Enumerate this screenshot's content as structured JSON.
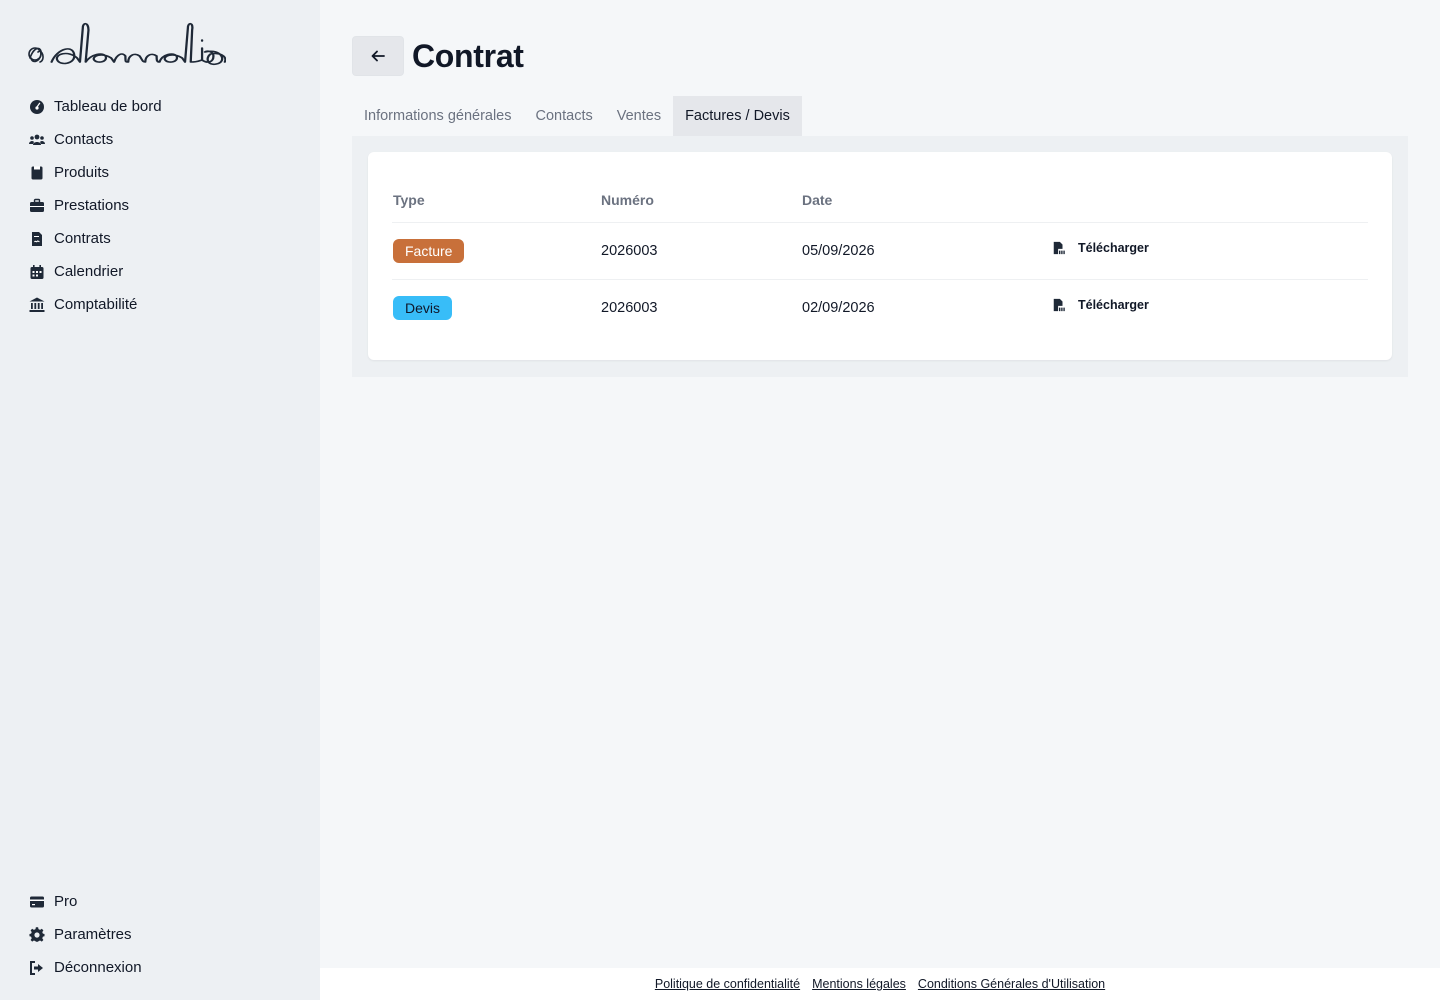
{
  "brand": {
    "logo_text": "ademelio"
  },
  "sidebar": {
    "items": [
      {
        "label": "Tableau de bord",
        "icon": "dashboard-gauge-icon"
      },
      {
        "label": "Contacts",
        "icon": "users-icon"
      },
      {
        "label": "Produits",
        "icon": "box-icon"
      },
      {
        "label": "Prestations",
        "icon": "briefcase-icon"
      },
      {
        "label": "Contrats",
        "icon": "file-contract-icon"
      },
      {
        "label": "Calendrier",
        "icon": "calendar-icon"
      },
      {
        "label": "Comptabilité",
        "icon": "bank-icon"
      }
    ],
    "bottom_items": [
      {
        "label": "Pro",
        "icon": "credit-card-icon"
      },
      {
        "label": "Paramètres",
        "icon": "gear-icon"
      },
      {
        "label": "Déconnexion",
        "icon": "sign-out-icon"
      }
    ]
  },
  "header": {
    "title": "Contrat",
    "back_icon": "arrow-left-icon"
  },
  "tabs": [
    {
      "label": "Informations générales",
      "active": false
    },
    {
      "label": "Contacts",
      "active": false
    },
    {
      "label": "Ventes",
      "active": false
    },
    {
      "label": "Factures / Devis",
      "active": true
    }
  ],
  "table": {
    "columns": [
      "Type",
      "Numéro",
      "Date",
      ""
    ],
    "rows": [
      {
        "type": "Facture",
        "type_color": "#c8703a",
        "type_text_color": "#ffffff",
        "number": "2026003",
        "date": "05/09/2026",
        "action": "Télécharger"
      },
      {
        "type": "Devis",
        "type_color": "#38bdf8",
        "type_text_color": "#0f172a",
        "number": "2026003",
        "date": "02/09/2026",
        "action": "Télécharger"
      }
    ]
  },
  "footer": {
    "links": [
      "Politique de confidentialité",
      "Mentions légales",
      "Conditions Générales d'Utilisation"
    ]
  },
  "colors": {
    "sidebar_bg": "#edf0f3",
    "main_bg": "#f5f7f9",
    "text": "#111827",
    "muted": "#6b7280"
  }
}
